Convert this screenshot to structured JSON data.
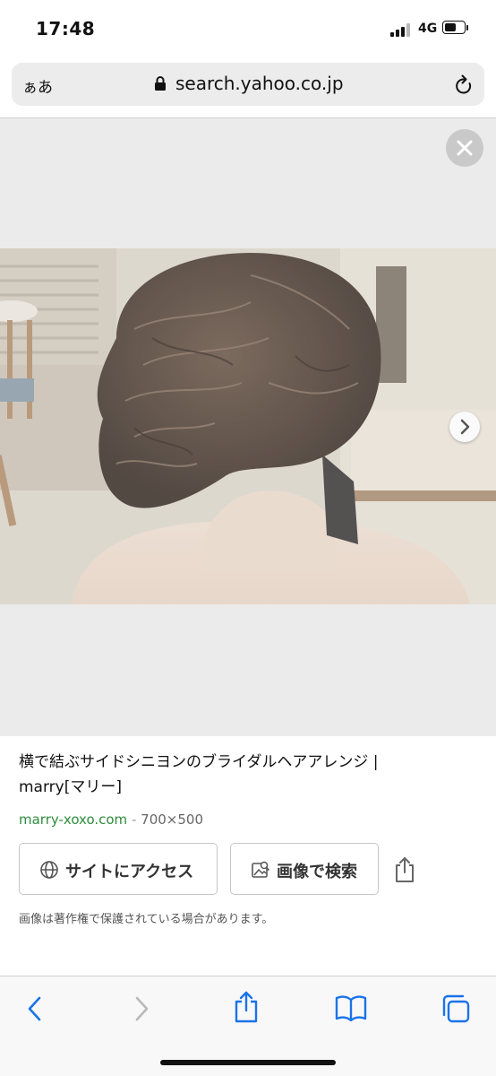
{
  "status_bar": {
    "time": "17:48",
    "network": "4G",
    "signal_icon": "cellular-signal-icon",
    "battery_icon": "battery-icon"
  },
  "browser": {
    "text_size_button": "ぁあ",
    "url": "search.yahoo.co.jp",
    "lock_icon": "lock-icon",
    "reload_icon": "reload-icon"
  },
  "viewer": {
    "close_icon": "close-icon",
    "next_icon": "chevron-right-icon",
    "image_subject": "bridal side chignon hairstyle photo (back view)"
  },
  "result": {
    "title": "横で結ぶサイドシニヨンのブライダルヘアアレンジ | marry[マリー]",
    "domain": "marry-xoxo.com",
    "separator": "-",
    "dimensions": "700×500",
    "visit_button": "サイトにアクセス",
    "visit_icon": "globe-icon",
    "image_search_button": "画像で検索",
    "image_search_icon": "image-search-icon",
    "share_icon": "share-icon",
    "copyright_note": "画像は著作権で保護されている場合があります。"
  },
  "toolbar": {
    "back_icon": "chevron-left-icon",
    "forward_icon": "chevron-right-icon",
    "share_icon": "share-icon",
    "bookmarks_icon": "book-icon",
    "tabs_icon": "tabs-icon"
  },
  "colors": {
    "accent": "#1a73e8",
    "domain_green": "#2f8c3d",
    "viewer_background": "#ebebeb",
    "address_bar": "#ececec"
  }
}
